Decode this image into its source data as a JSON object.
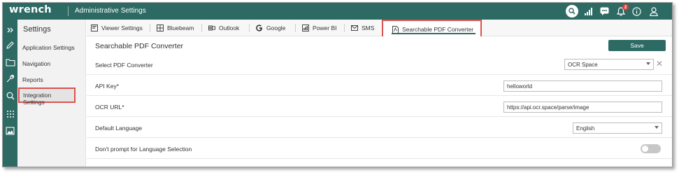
{
  "header": {
    "logo": "wrench",
    "title": "Administrative Settings",
    "notification_count": "2"
  },
  "sidebar": {
    "title": "Settings",
    "items": [
      {
        "label": "Application Settings"
      },
      {
        "label": "Navigation"
      },
      {
        "label": "Reports"
      },
      {
        "label": "Integration Settings"
      }
    ]
  },
  "tabs": [
    {
      "label": "Viewer Settings"
    },
    {
      "label": "Bluebeam"
    },
    {
      "label": "Outlook"
    },
    {
      "label": "Google"
    },
    {
      "label": "Power BI"
    },
    {
      "label": "SMS"
    },
    {
      "label": "Searchable PDF Converter"
    }
  ],
  "content": {
    "heading": "Searchable PDF Converter",
    "save_label": "Save",
    "rows": {
      "converter": {
        "label": "Select PDF Converter",
        "value": "OCR Space"
      },
      "api_key": {
        "label": "API Key*",
        "value": "helloworld"
      },
      "ocr_url": {
        "label": "OCR URL*",
        "value": "https://api.ocr.space/parse/image"
      },
      "language": {
        "label": "Default Language",
        "value": "English"
      },
      "prompt": {
        "label": "Don't prompt for Language Selection",
        "value": false
      }
    }
  },
  "colors": {
    "brand": "#2d6a63",
    "highlight": "#d9534f"
  }
}
